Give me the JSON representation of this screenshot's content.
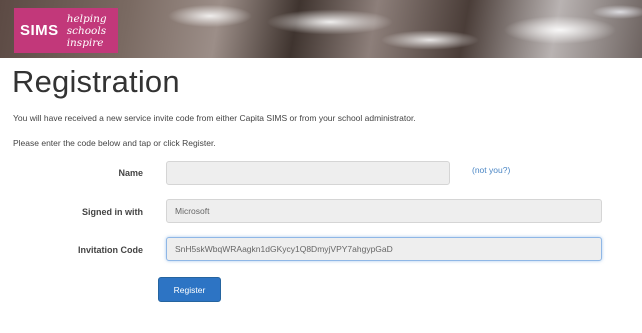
{
  "header": {
    "logo_text": "SIMS",
    "tagline": [
      "helping",
      "schools",
      "inspire"
    ]
  },
  "page": {
    "title": "Registration",
    "info_line_1": "You will have received a new service invite code from either Capita SIMS or from your school administrator.",
    "info_line_2": "Please enter the code below and tap or click Register."
  },
  "form": {
    "name_label": "Name",
    "name_value": "",
    "not_you_link": "(not you?)",
    "signed_in_label": "Signed in with",
    "signed_in_value": "Microsoft",
    "invitation_label": "Invitation Code",
    "invitation_value": "SnH5skWbqWRAagkn1dGKycy1Q8DmyjVPY7ahgypGaD",
    "register_button": "Register"
  },
  "colors": {
    "logo_pink": "#c2387a",
    "button_blue": "#2d74c4",
    "link_blue": "#4a86c5"
  }
}
